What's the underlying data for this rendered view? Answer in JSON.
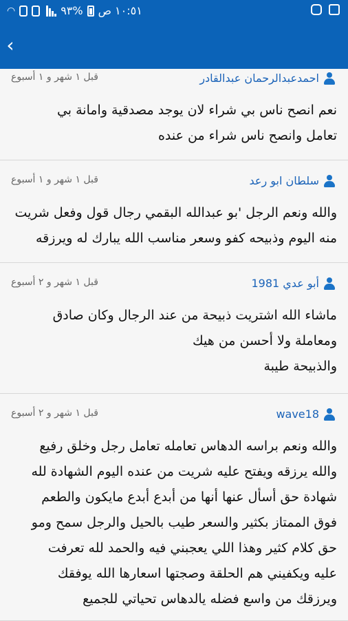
{
  "status": {
    "time": "١٠:٥١ ص",
    "battery": "%٩٣"
  },
  "comments": [
    {
      "user": "احمدعبدالرحمان عبدالقادر",
      "time": "قبل ١ شهر و ١ أسبوع",
      "body": "نعم انصح ناس بي شراء لان يوجد مصدقية وامانة بي\nتعامل وانصح ناس شراء من عنده"
    },
    {
      "user": "سلطان ابو رعد",
      "time": "قبل ١ شهر و ١ أسبوع",
      "body": "والله ونعم الرجل 'بو عبدالله البقمي رجال قول وفعل شريت\nمنه اليوم وذبيحه كفو وسعر مناسب الله يبارك له ويرزقه"
    },
    {
      "user": "أبو عدي 1981",
      "time": "قبل ١ شهر و ٢ أسبوع",
      "body": "ماشاء الله اشتريت ذبيحة من عند الرجال وكان صادق\nومعاملة ولا أحسن من هيك\nوالذبيحة طيبة"
    },
    {
      "user": "wave18",
      "time": "قبل ١ شهر و ٢ أسبوع",
      "body": "والله ونعم براسه الدهاس تعامله تعامل رجل وخلق رفيع\nوالله يرزقه ويفتح عليه شريت من عنده اليوم الشهادة لله\nشهادة حق أسأل عنها أنها من أبدع أبدع مايكون والطعم\nفوق الممتاز بكثير والسعر طيب بالحيل والرجل سمح ومو\nحق كلام كثير وهذا اللي يعجبني فيه والحمد لله تعرفت\nعليه ويكفيني هم الحلقة وصجتها اسعارها الله يوفقك\nويرزقك من واسع فضله يالدهاس تحياتي للجميع"
    }
  ]
}
